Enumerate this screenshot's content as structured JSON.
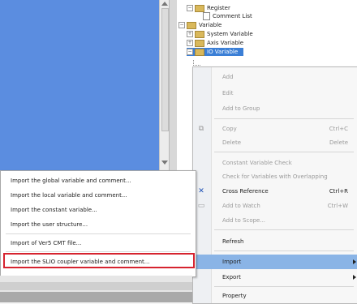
{
  "tree": {
    "register": "Register",
    "comment_list": "Comment List",
    "variable": "Variable",
    "system_variable": "System Variable",
    "axis_variable": "Axis Variable",
    "io_variable": "IO Variable"
  },
  "context_menu": {
    "add": "Add",
    "edit": "Edit",
    "add_to_group": "Add to Group",
    "copy": "Copy",
    "copy_shortcut": "Ctrl+C",
    "delete": "Delete",
    "delete_shortcut": "Delete",
    "constant_variable_check": "Constant Variable Check",
    "check_overlapping": "Check for Variables with Overlapping",
    "cross_reference": "Cross Reference",
    "cross_reference_shortcut": "Ctrl+R",
    "add_to_watch": "Add to Watch",
    "add_to_watch_shortcut": "Ctrl+W",
    "add_to_scope": "Add to Scope...",
    "refresh": "Refresh",
    "import": "Import",
    "export": "Export",
    "property": "Property"
  },
  "import_submenu": {
    "items": [
      "Import the global variable and comment...",
      "Import the local variable and comment...",
      "Import the constant variable...",
      "Import the user structure...",
      "Import of Ver5 CMT file...",
      "Import the SLIO coupler variable and comment..."
    ]
  },
  "colors": {
    "editor_background": "#5b8de0",
    "menu_highlight": "#8ab4e6",
    "selection": "#3b7fd6",
    "callout_border": "#d6232f"
  }
}
